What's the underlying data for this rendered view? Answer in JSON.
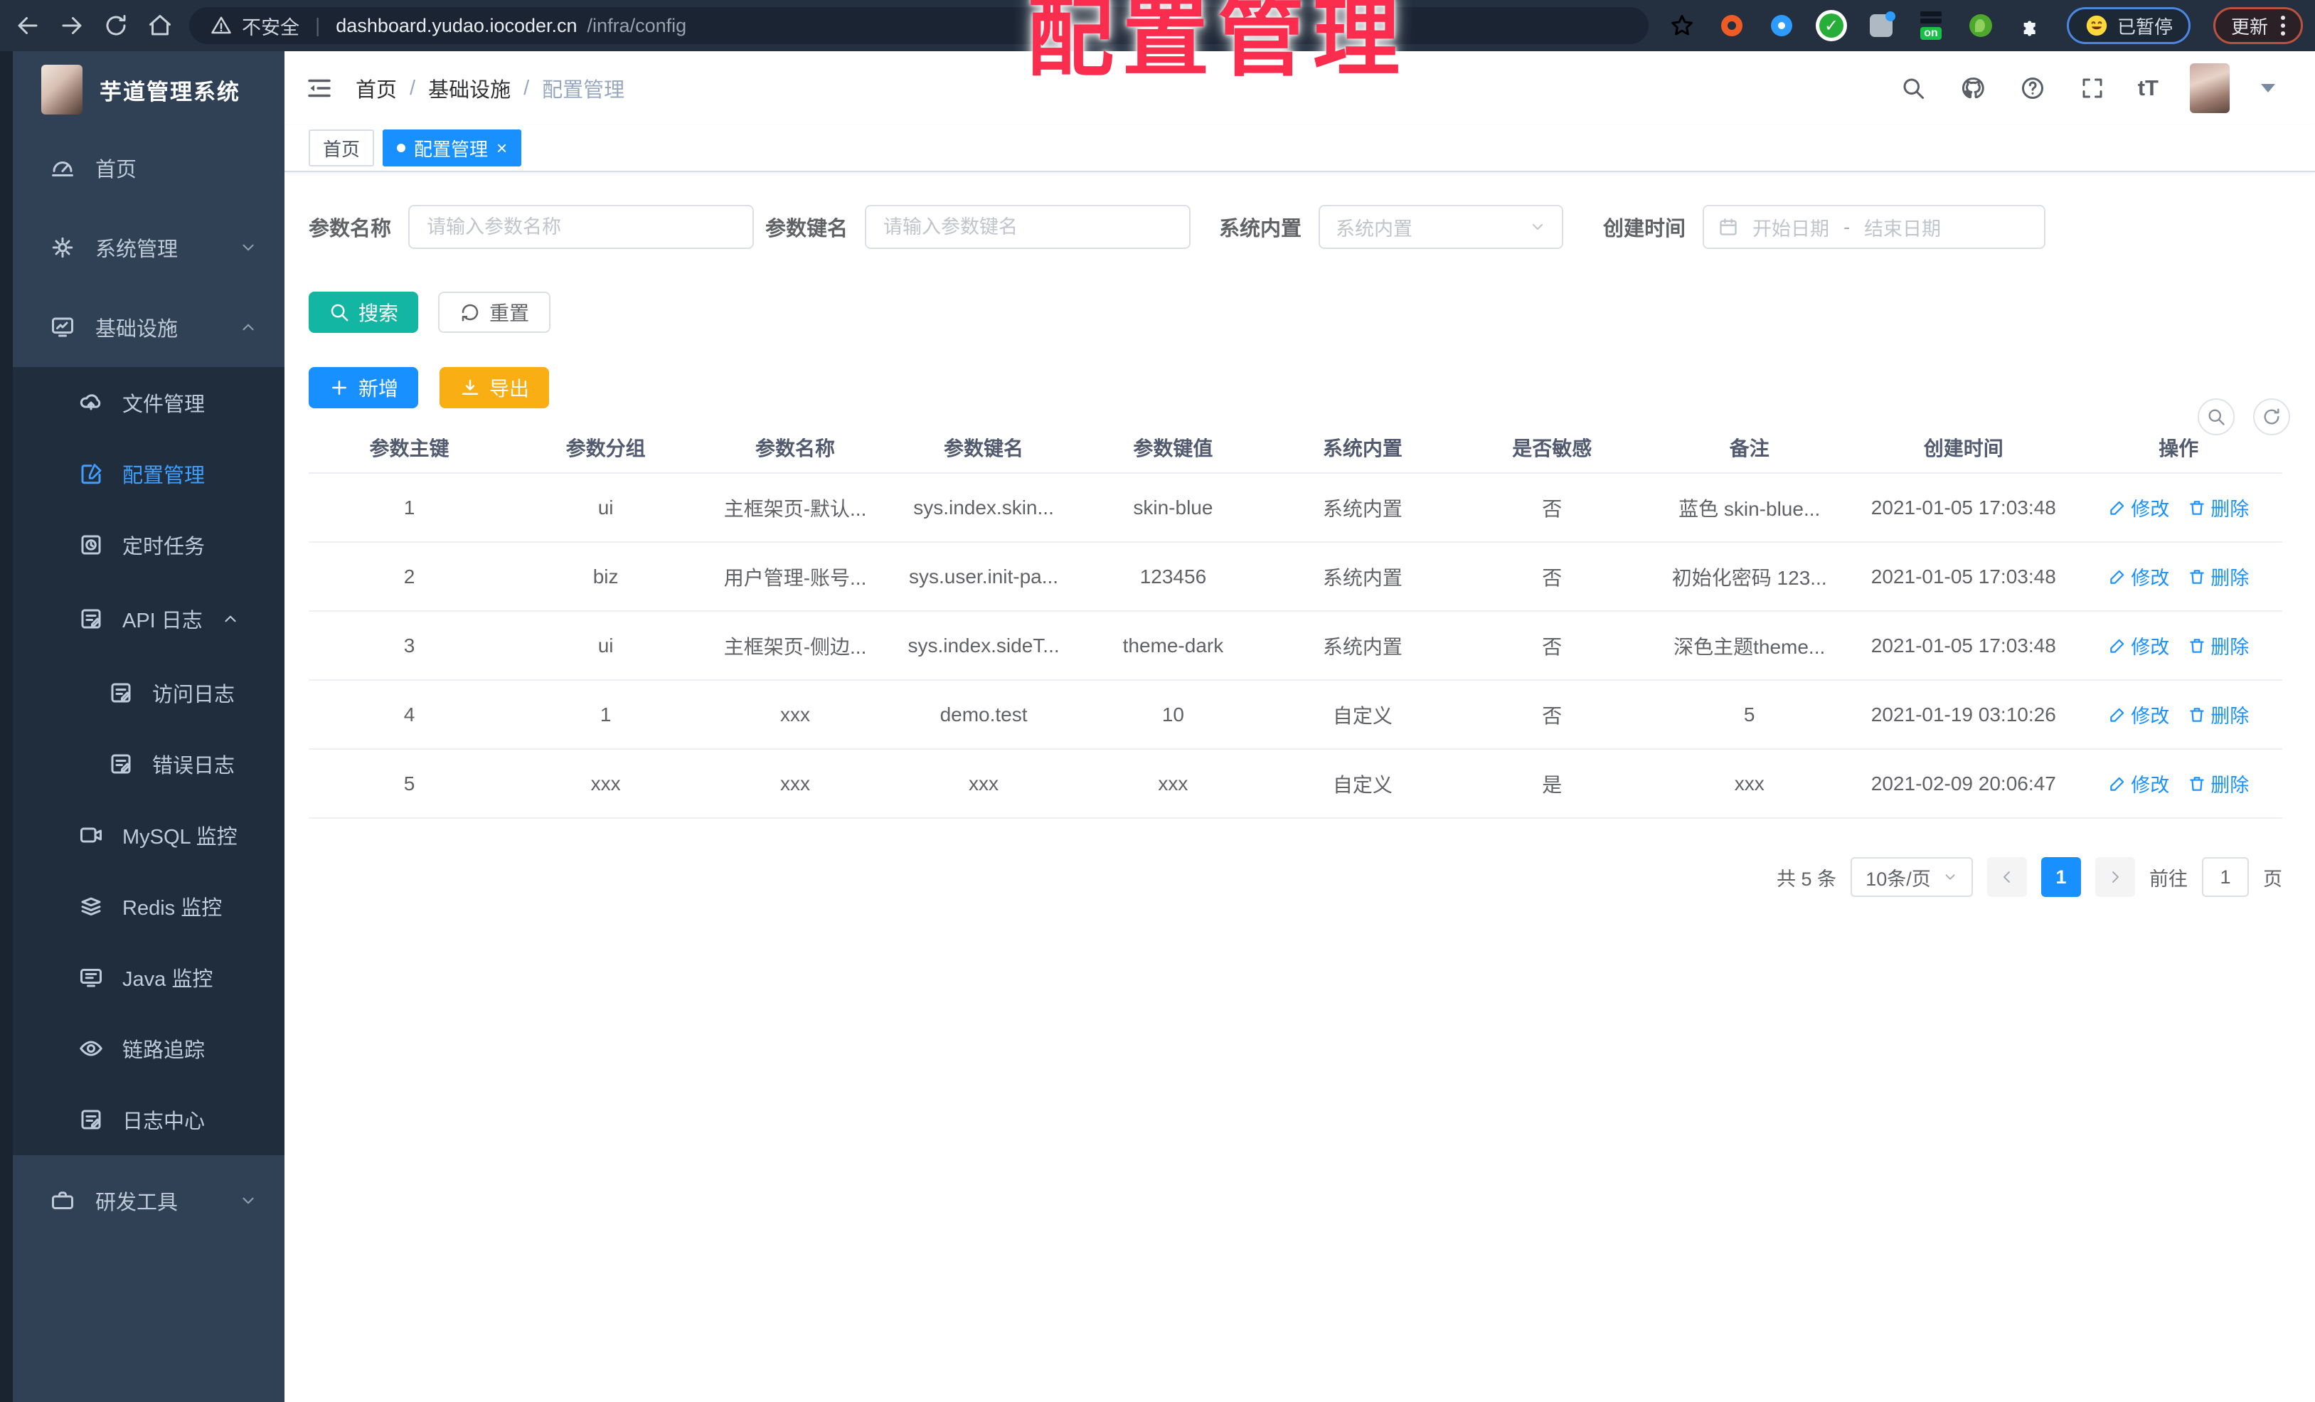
{
  "browser": {
    "security": "不安全",
    "host": "dashboard.yudao.iocoder.cn",
    "path": "/infra/config",
    "ext_badge": "on",
    "paused": "已暂停",
    "update": "更新"
  },
  "watermark": "配置管理",
  "sidebar": {
    "logo_title": "芋道管理系统",
    "items": {
      "home": "首页",
      "system": "系统管理",
      "infra": "基础设施",
      "file": "文件管理",
      "config": "配置管理",
      "job": "定时任务",
      "api_log": "API 日志",
      "access_log": "访问日志",
      "error_log": "错误日志",
      "mysql": "MySQL 监控",
      "redis": "Redis 监控",
      "java": "Java 监控",
      "trace": "链路追踪",
      "log_center": "日志中心",
      "devtools": "研发工具"
    }
  },
  "header": {
    "breadcrumb": [
      "首页",
      "基础设施",
      "配置管理"
    ],
    "font_size_button": "tT"
  },
  "tabs": {
    "home": "首页",
    "active": "配置管理",
    "close": "×"
  },
  "filters": {
    "name_label": "参数名称",
    "name_placeholder": "请输入参数名称",
    "key_label": "参数键名",
    "key_placeholder": "请输入参数键名",
    "type_label": "系统内置",
    "type_placeholder": "系统内置",
    "date_label": "创建时间",
    "date_start": "开始日期",
    "date_sep": "-",
    "date_end": "结束日期"
  },
  "buttons": {
    "search": "搜索",
    "reset": "重置",
    "add": "新增",
    "export": "导出"
  },
  "table": {
    "headers": [
      "参数主键",
      "参数分组",
      "参数名称",
      "参数键名",
      "参数键值",
      "系统内置",
      "是否敏感",
      "备注",
      "创建时间",
      "操作"
    ],
    "edit": "修改",
    "delete": "删除",
    "rows": [
      {
        "c": [
          "1",
          "ui",
          "主框架页-默认...",
          "sys.index.skin...",
          "skin-blue",
          "系统内置",
          "否",
          "蓝色 skin-blue...",
          "2021-01-05 17:03:48"
        ]
      },
      {
        "c": [
          "2",
          "biz",
          "用户管理-账号...",
          "sys.user.init-pa...",
          "123456",
          "系统内置",
          "否",
          "初始化密码 123...",
          "2021-01-05 17:03:48"
        ]
      },
      {
        "c": [
          "3",
          "ui",
          "主框架页-侧边...",
          "sys.index.sideT...",
          "theme-dark",
          "系统内置",
          "否",
          "深色主题theme...",
          "2021-01-05 17:03:48"
        ]
      },
      {
        "c": [
          "4",
          "1",
          "xxx",
          "demo.test",
          "10",
          "自定义",
          "否",
          "5",
          "2021-01-19 03:10:26"
        ]
      },
      {
        "c": [
          "5",
          "xxx",
          "xxx",
          "xxx",
          "xxx",
          "自定义",
          "是",
          "xxx",
          "2021-02-09 20:06:47"
        ]
      }
    ]
  },
  "pagination": {
    "total": "共 5 条",
    "page_size": "10条/页",
    "current_page": "1",
    "goto": "前往",
    "jump_value": "1",
    "unit": "页"
  },
  "colors": {
    "primary": "#1890ff",
    "search_teal": "#13b5a3",
    "export_amber": "#f9ae13",
    "sidebar_bg": "#304156",
    "submenu_bg": "#1f2d3d",
    "chrome_bg": "#243040",
    "watermark_red": "#fb2d4f",
    "menu_text": "#bfcbd9",
    "active_menu": "#409eff"
  }
}
